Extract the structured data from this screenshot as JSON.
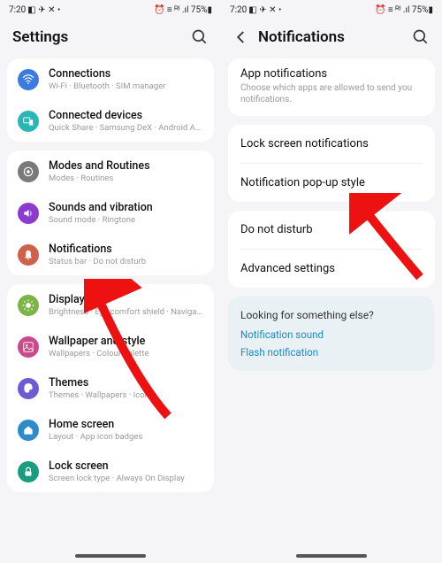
{
  "status": {
    "time": "7:20",
    "icons_left": "◧ ✈ ✕ •",
    "icons_right": "⏰ ≡ ᴿᴵ .ıl 75%▮",
    "battery": "75%"
  },
  "left": {
    "title": "Settings",
    "groups": [
      [
        {
          "icon": "wifi",
          "color": "#3b7be0",
          "title": "Connections",
          "sub": "Wi-Fi · Bluetooth · SIM manager"
        },
        {
          "icon": "devices",
          "color": "#2bb6b6",
          "title": "Connected devices",
          "sub": "Quick Share · Samsung DeX · Android Auto"
        }
      ],
      [
        {
          "icon": "modes",
          "color": "#7a7a7a",
          "title": "Modes and Routines",
          "sub": "Modes · Routines"
        },
        {
          "icon": "sound",
          "color": "#8b3bd0",
          "title": "Sounds and vibration",
          "sub": "Sound mode · Ringtone"
        },
        {
          "icon": "notif",
          "color": "#d0604a",
          "title": "Notifications",
          "sub": "Status bar · Do not disturb"
        }
      ],
      [
        {
          "icon": "display",
          "color": "#7bb447",
          "title": "Display",
          "sub": "Brightness · Eye comfort shield · Navigation bar"
        },
        {
          "icon": "wallpaper",
          "color": "#c94a8a",
          "title": "Wallpaper and style",
          "sub": "Wallpapers · Colour palette"
        },
        {
          "icon": "themes",
          "color": "#6d5bd4",
          "title": "Themes",
          "sub": "Themes · Wallpapers · Icons"
        },
        {
          "icon": "home",
          "color": "#2f8acb",
          "title": "Home screen",
          "sub": "Layout · App icon badges"
        },
        {
          "icon": "lock",
          "color": "#1a9c7f",
          "title": "Lock screen",
          "sub": "Screen lock type · Always On Display"
        }
      ]
    ]
  },
  "right": {
    "title": "Notifications",
    "items": {
      "app_notif": {
        "title": "App notifications",
        "sub": "Choose which apps are allowed to send you notifications."
      },
      "lock": "Lock screen notifications",
      "popup": "Notification pop-up style",
      "dnd": "Do not disturb",
      "advanced": "Advanced settings"
    },
    "looking": {
      "title": "Looking for something else?",
      "links": [
        "Notification sound",
        "Flash notification"
      ]
    }
  }
}
